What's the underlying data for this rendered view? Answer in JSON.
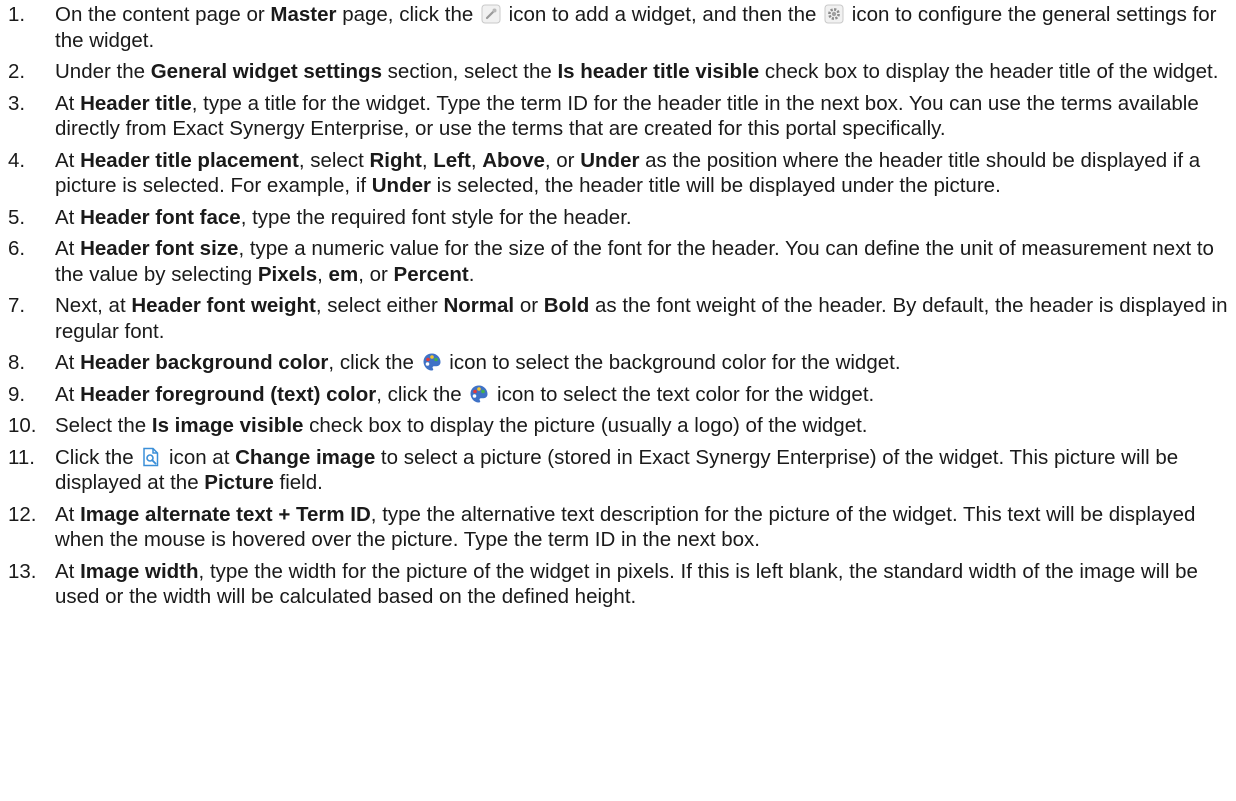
{
  "steps": [
    {
      "num": "1.",
      "parts": [
        {
          "t": "On the content page or "
        },
        {
          "b": "Master"
        },
        {
          "t": " page, click the "
        },
        {
          "icon": "add-widget-icon"
        },
        {
          "t": " icon to add a widget, and then the "
        },
        {
          "icon": "gear-icon"
        },
        {
          "t": " icon to configure the general settings for the widget."
        }
      ]
    },
    {
      "num": "2.",
      "parts": [
        {
          "t": "Under the "
        },
        {
          "b": "General widget settings"
        },
        {
          "t": " section, select the "
        },
        {
          "b": "Is header title visible"
        },
        {
          "t": " check box to display the header title of the widget."
        }
      ]
    },
    {
      "num": "3.",
      "parts": [
        {
          "t": "At "
        },
        {
          "b": "Header title"
        },
        {
          "t": ", type a title for the widget. Type the term ID for the header title in the next box. You can use the terms available directly from Exact Synergy Enterprise, or use the terms that are created for this portal specifically."
        }
      ]
    },
    {
      "num": "4.",
      "parts": [
        {
          "t": "At "
        },
        {
          "b": "Header title placement"
        },
        {
          "t": ", select "
        },
        {
          "b": "Right"
        },
        {
          "t": ", "
        },
        {
          "b": "Left"
        },
        {
          "t": ", "
        },
        {
          "b": "Above"
        },
        {
          "t": ", or "
        },
        {
          "b": "Under"
        },
        {
          "t": " as the position where the header title should be displayed if a picture is selected. For example, if "
        },
        {
          "b": "Under"
        },
        {
          "t": " is selected, the header title will be displayed under the picture."
        }
      ]
    },
    {
      "num": "5.",
      "parts": [
        {
          "t": "At "
        },
        {
          "b": "Header font face"
        },
        {
          "t": ", type the required font style for the header."
        }
      ]
    },
    {
      "num": "6.",
      "parts": [
        {
          "t": "At "
        },
        {
          "b": "Header font size"
        },
        {
          "t": ", type a numeric value for the size of the font for the header. You can define the unit of measurement next to the value by selecting "
        },
        {
          "b": "Pixels"
        },
        {
          "t": ", "
        },
        {
          "b": "em"
        },
        {
          "t": ", or "
        },
        {
          "b": "Percent"
        },
        {
          "t": "."
        }
      ]
    },
    {
      "num": "7.",
      "parts": [
        {
          "t": "Next, at "
        },
        {
          "b": "Header font weight"
        },
        {
          "t": ", select either "
        },
        {
          "b": "Normal"
        },
        {
          "t": " or "
        },
        {
          "b": "Bold"
        },
        {
          "t": " as the font weight of the header. By default, the header is displayed in regular font."
        }
      ]
    },
    {
      "num": "8.",
      "parts": [
        {
          "t": "At "
        },
        {
          "b": "Header background color"
        },
        {
          "t": ", click the "
        },
        {
          "icon": "palette-icon"
        },
        {
          "t": " icon to select the background color for the widget."
        }
      ]
    },
    {
      "num": "9.",
      "parts": [
        {
          "t": "At "
        },
        {
          "b": "Header foreground (text) color"
        },
        {
          "t": ", click the "
        },
        {
          "icon": "palette-icon"
        },
        {
          "t": " icon to select the text color for the widget."
        }
      ]
    },
    {
      "num": "10.",
      "parts": [
        {
          "t": "Select the "
        },
        {
          "b": "Is image visible"
        },
        {
          "t": " check box to display the picture (usually a logo) of the widget."
        }
      ]
    },
    {
      "num": "11.",
      "parts": [
        {
          "t": "Click the "
        },
        {
          "icon": "change-image-icon"
        },
        {
          "t": " icon at "
        },
        {
          "b": "Change image"
        },
        {
          "t": " to select a picture (stored in Exact Synergy Enterprise) of the widget. This picture will be displayed at the "
        },
        {
          "b": "Picture"
        },
        {
          "t": " field."
        }
      ]
    },
    {
      "num": "12.",
      "parts": [
        {
          "t": "At "
        },
        {
          "b": "Image alternate text + Term ID"
        },
        {
          "t": ", type the alternative text description for the picture of the widget. This text will be displayed when the mouse is hovered over the picture. Type the term ID in the next box."
        }
      ]
    },
    {
      "num": "13.",
      "parts": [
        {
          "t": "At "
        },
        {
          "b": "Image width"
        },
        {
          "t": ", type the width for the picture of the widget in pixels. If this is left blank, the standard width of the image will be used or the width will be calculated based on the defined height."
        }
      ]
    }
  ]
}
